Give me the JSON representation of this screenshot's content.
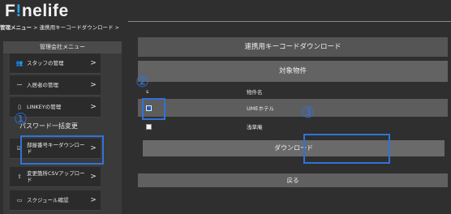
{
  "app": {
    "logo_prefix": "F",
    "logo_accent": "!",
    "logo_suffix": "nelife"
  },
  "breadcrumb": {
    "part1": "管理メニュー",
    "sep": " > ",
    "part2": "連携用キーコードダウンロード",
    "tail": " >"
  },
  "sidebar": {
    "title": "管理会社メニュー",
    "items": [
      {
        "icon": "staff-icon",
        "glyph": "👥",
        "label": "スタッフの管理",
        "chevron": ">"
      },
      {
        "icon": "resident-icon",
        "glyph": "ꟷ",
        "label": "入居者の管理",
        "chevron": ">"
      },
      {
        "icon": "key-icon",
        "glyph": "▯",
        "label": "LINKEYの管理",
        "chevron": ">"
      },
      {
        "icon": "download-key-icon",
        "glyph": "☑",
        "label": "部屋番号キーダウンロード",
        "chevron": ">"
      },
      {
        "icon": "csv-upload-icon",
        "glyph": "⇧",
        "label": "変更箇所CSVアップロード",
        "chevron": ">"
      },
      {
        "icon": "calendar-icon",
        "glyph": "▭",
        "label": "スクジュール確認",
        "chevron": ">"
      }
    ],
    "section_label": "パスワード一括変更"
  },
  "main": {
    "title": "連携用キーコードダウンロード",
    "subtitle": "対象物件",
    "table": {
      "col_check": "s",
      "col_name": "物件名",
      "rows": [
        {
          "checked": true,
          "name": "UMEホテル"
        },
        {
          "checked": false,
          "name": "浅草庵"
        }
      ]
    },
    "download_label": "ダウンロード",
    "back_label": "戻る"
  },
  "annotations": {
    "n1": "①",
    "n2": "②",
    "n3": "③",
    "color": "#2f73d8"
  }
}
